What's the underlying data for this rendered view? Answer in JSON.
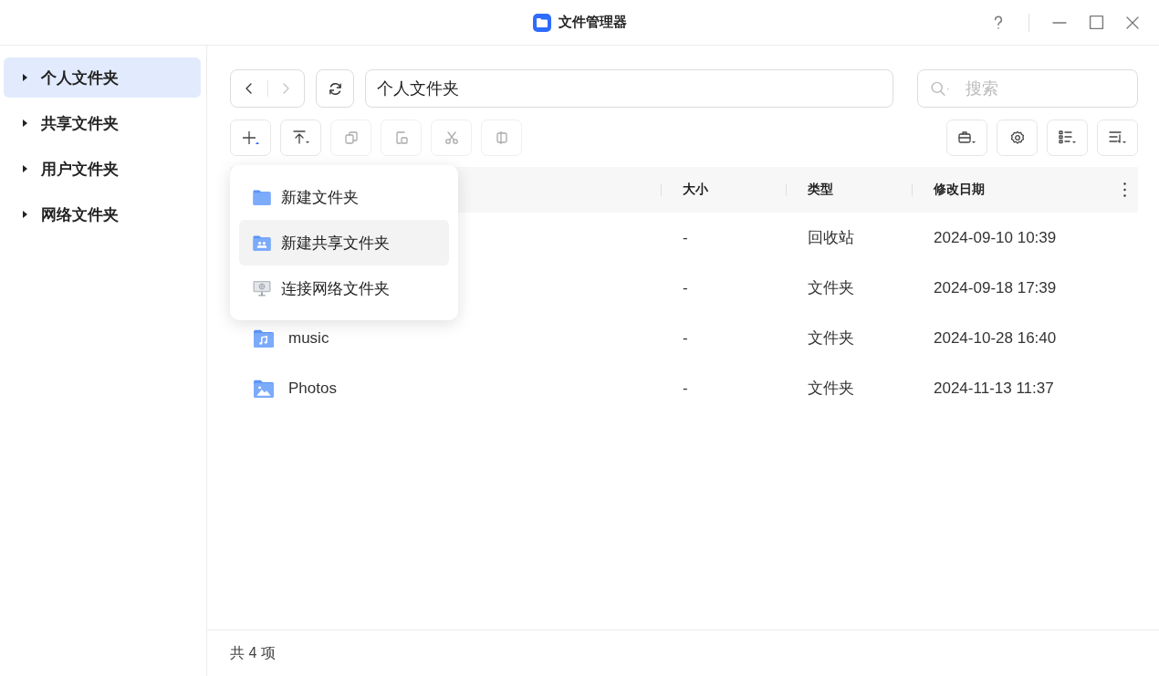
{
  "window": {
    "title": "文件管理器"
  },
  "sidebar": {
    "items": [
      {
        "label": "个人文件夹",
        "selected": true
      },
      {
        "label": "共享文件夹",
        "selected": false
      },
      {
        "label": "用户文件夹",
        "selected": false
      },
      {
        "label": "网络文件夹",
        "selected": false
      }
    ]
  },
  "nav": {
    "back_disabled": false,
    "forward_disabled": true,
    "path": "个人文件夹"
  },
  "search": {
    "placeholder": "搜索"
  },
  "toolbar_left": [
    {
      "kind": "add",
      "disabled": false
    },
    {
      "kind": "upload",
      "disabled": false
    },
    {
      "kind": "copy",
      "disabled": true
    },
    {
      "kind": "paste",
      "disabled": true
    },
    {
      "kind": "cut",
      "disabled": true
    },
    {
      "kind": "move",
      "disabled": true
    }
  ],
  "toolbar_right": [
    {
      "kind": "tools"
    },
    {
      "kind": "settings"
    },
    {
      "kind": "view"
    },
    {
      "kind": "sort"
    }
  ],
  "table": {
    "columns": [
      "大小",
      "类型",
      "修改日期"
    ],
    "rows": [
      {
        "size": "-",
        "type": "回收站",
        "modified": "2024-09-10 10:39"
      },
      {
        "size": "-",
        "type": "文件夹",
        "modified": "2024-09-18 17:39"
      },
      {
        "kind": "music",
        "name": "music",
        "size": "-",
        "type": "文件夹",
        "modified": "2024-10-28 16:40"
      },
      {
        "kind": "photos",
        "name": "Photos",
        "size": "-",
        "type": "文件夹",
        "modified": "2024-11-13 11:37"
      }
    ]
  },
  "menu": {
    "items": [
      {
        "kind": "folder",
        "label": "新建文件夹",
        "selected": false
      },
      {
        "kind": "shared",
        "label": "新建共享文件夹",
        "selected": true
      },
      {
        "kind": "network",
        "label": "连接网络文件夹",
        "selected": false
      }
    ]
  },
  "status_bar": {
    "text": "共 4 项"
  }
}
